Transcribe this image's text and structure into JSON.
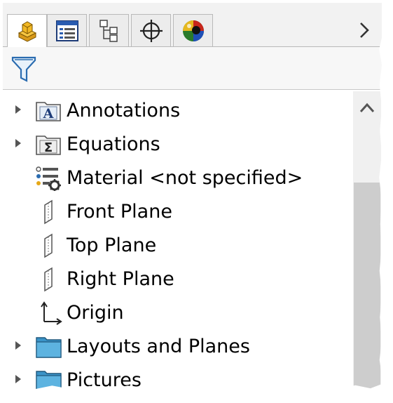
{
  "tabs": [
    {
      "name": "featuremanager-tab",
      "icon": "part-icon",
      "active": true
    },
    {
      "name": "propertymanager-tab",
      "icon": "property-list-icon",
      "active": false
    },
    {
      "name": "configurationmanager-tab",
      "icon": "configuration-icon",
      "active": false
    },
    {
      "name": "dimxpert-tab",
      "icon": "crosshair-icon",
      "active": false
    },
    {
      "name": "display-manager-tab",
      "icon": "appearance-sphere-icon",
      "active": false
    }
  ],
  "tabbar": {
    "more_icon": "chevron-right-icon"
  },
  "filter": {
    "icon": "funnel-icon"
  },
  "tree": {
    "items": [
      {
        "label": "Annotations",
        "icon": "annotations-folder-icon",
        "expandable": true
      },
      {
        "label": "Equations",
        "icon": "equations-folder-icon",
        "expandable": true
      },
      {
        "label": "Material <not specified>",
        "icon": "material-icon",
        "expandable": false
      },
      {
        "label": "Front Plane",
        "icon": "plane-icon",
        "expandable": false
      },
      {
        "label": "Top Plane",
        "icon": "plane-icon",
        "expandable": false
      },
      {
        "label": "Right Plane",
        "icon": "plane-icon",
        "expandable": false
      },
      {
        "label": "Origin",
        "icon": "origin-icon",
        "expandable": false
      },
      {
        "label": "Layouts and Planes",
        "icon": "folder-icon",
        "expandable": true
      },
      {
        "label": "Pictures",
        "icon": "folder-icon",
        "expandable": true
      }
    ]
  },
  "scrollbar": {
    "up_icon": "scroll-up-icon"
  },
  "colors": {
    "folder": "#4aa8d8",
    "tab_bg": "#ececec",
    "scroll_thumb": "#cdcdcd"
  }
}
